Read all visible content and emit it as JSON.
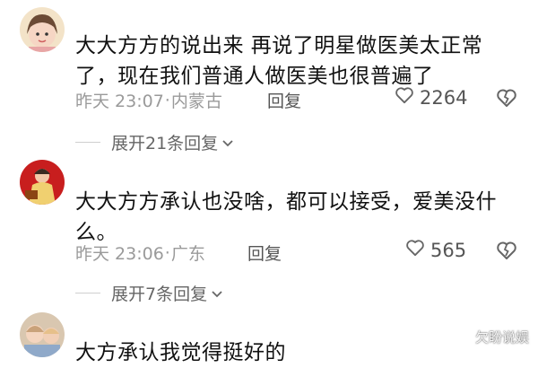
{
  "comments": [
    {
      "text": "大大方方的说出来 再说了明星做医美太正常了，现在我们普通人做医美也很普遍了",
      "time": "昨天 23:07",
      "location": "内蒙古",
      "reply_label": "回复",
      "likes": "2264",
      "expand_label": "展开21条回复"
    },
    {
      "text": "大大方方承认也没啥，都可以接受，爱美没什么。",
      "time": "昨天 23:06",
      "location": "广东",
      "reply_label": "回复",
      "likes": "565",
      "expand_label": "展开7条回复"
    },
    {
      "text": "大方承认我觉得挺好的"
    }
  ],
  "watermark": "欠盼说娱",
  "icons": {
    "like": "heart-outline-icon",
    "dislike": "broken-heart-icon",
    "expand": "chevron-down-icon",
    "watermark": "logo-icon"
  }
}
